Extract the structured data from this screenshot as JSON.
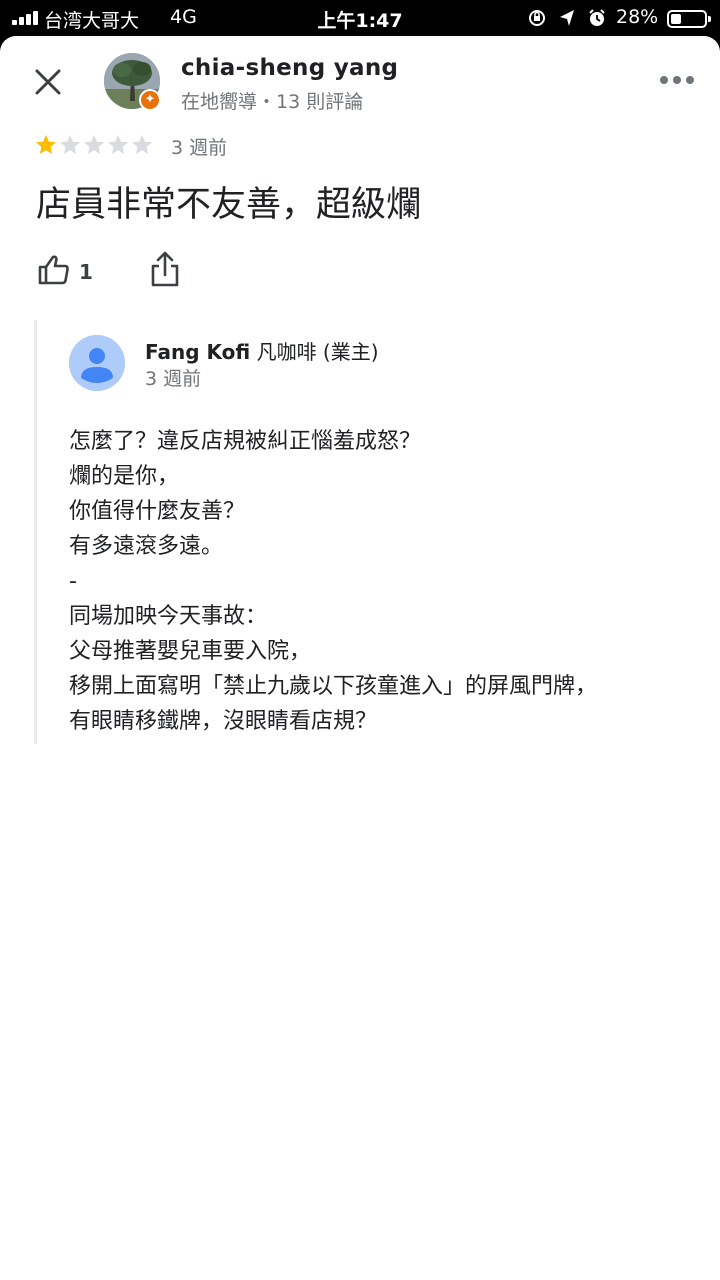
{
  "status_bar": {
    "carrier": "台湾大哥大",
    "network": "4G",
    "time": "上午1:47",
    "battery": "28%"
  },
  "review": {
    "author_name": "chia-sheng yang",
    "author_meta": "在地嚮導・13 則評論",
    "rating": 1,
    "max_rating": 5,
    "date": "3 週前",
    "text": "店員非常不友善，超級爛",
    "like_count": "1"
  },
  "owner_reply": {
    "name_bold": "Fang Kofi",
    "name_rest": " 凡咖啡 (業主)",
    "date": "3 週前",
    "lines": [
      "怎麼了？違反店規被糾正惱羞成怒？",
      "爛的是你，",
      "你值得什麼友善？",
      "有多遠滾多遠。",
      "-",
      "同場加映今天事故：",
      "父母推著嬰兒車要入院，",
      "移開上面寫明「禁止九歲以下孩童進入」的屏風門牌，",
      "有眼睛移鐵牌，沒眼睛看店規？"
    ]
  },
  "colors": {
    "star_filled": "#fbbc04",
    "star_empty": "#dadce0",
    "guide_badge": "#e8710a",
    "owner_avatar_bg": "#aecbfa",
    "owner_avatar_fg": "#4285f4"
  },
  "icons": [
    "close-icon",
    "more-vert-icon",
    "thumb-up-icon",
    "share-icon",
    "local-guide-icon",
    "location-arrow-icon",
    "alarm-icon",
    "orientation-lock-icon"
  ]
}
